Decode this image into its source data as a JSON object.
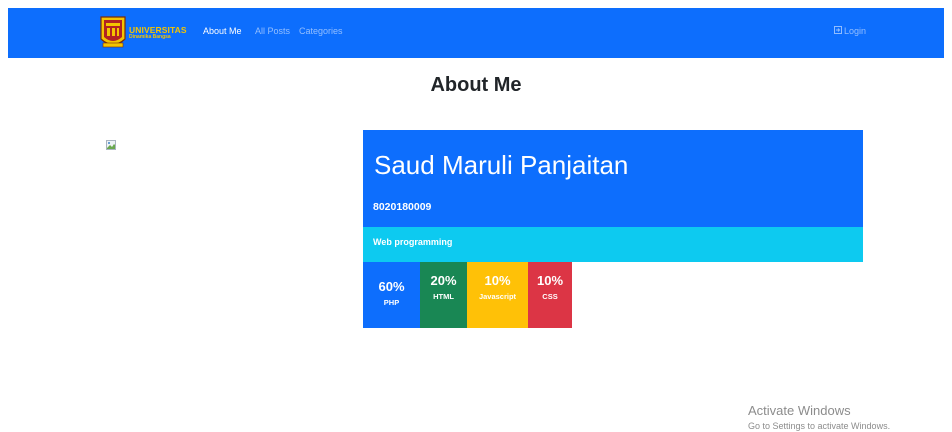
{
  "navbar": {
    "logo": {
      "line1": "UNIVERSITAS",
      "line2": "Dinamika Bangsa"
    },
    "links": [
      {
        "label": "About Me",
        "active": true
      },
      {
        "label": "All Posts",
        "active": false
      },
      {
        "label": "Categories",
        "active": false
      }
    ],
    "login_label": "Login",
    "login_icon": "login-icon"
  },
  "page": {
    "title": "About Me"
  },
  "profile": {
    "image_icon": "broken-image-icon",
    "name": "Saud Maruli Panjaitan",
    "nim": "8020180009",
    "course": "Web programming"
  },
  "skills": [
    {
      "percent": "60%",
      "label": "PHP",
      "value": 60,
      "color": "#0d6efd"
    },
    {
      "percent": "20%",
      "label": "HTML",
      "value": 20,
      "color": "#198754"
    },
    {
      "percent": "10%",
      "label": "Javascript",
      "value": 10,
      "color": "#ffc107"
    },
    {
      "percent": "10%",
      "label": "CSS",
      "value": 10,
      "color": "#dc3545"
    }
  ],
  "colors": {
    "primary": "#0d6efd",
    "info": "#0dcaf0",
    "logo_text": "#f4c400"
  },
  "watermark": {
    "title": "Activate Windows",
    "subtitle": "Go to Settings to activate Windows."
  }
}
